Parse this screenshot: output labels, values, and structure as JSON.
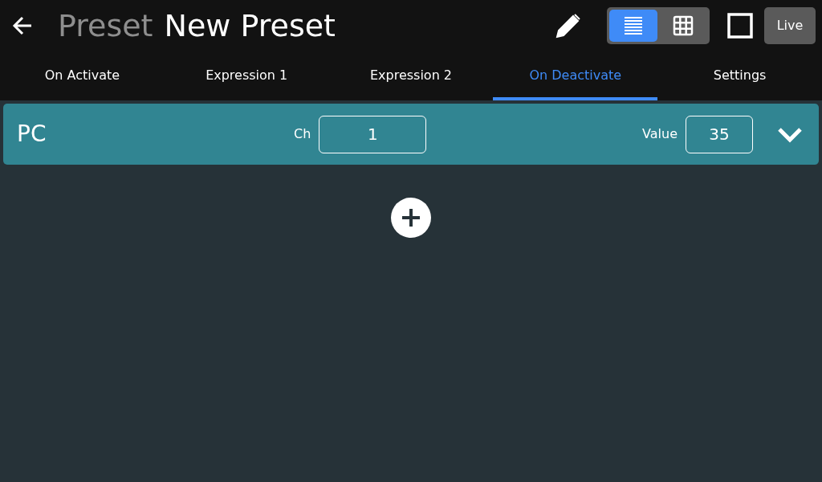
{
  "header": {
    "section": "Preset",
    "title": "New Preset",
    "view_modes": [
      {
        "kind": "list",
        "selected": true
      },
      {
        "kind": "grid",
        "selected": false
      }
    ],
    "live_button": "Live"
  },
  "tabs": [
    {
      "label": "On Activate",
      "selected": false
    },
    {
      "label": "Expression 1",
      "selected": false
    },
    {
      "label": "Expression 2",
      "selected": false
    },
    {
      "label": "On Deactivate",
      "selected": true
    },
    {
      "label": "Settings",
      "selected": false
    }
  ],
  "messages": [
    {
      "type": "PC",
      "fields": [
        {
          "label": "Ch",
          "value": "1"
        },
        {
          "label": "Value",
          "value": "35"
        }
      ]
    }
  ]
}
